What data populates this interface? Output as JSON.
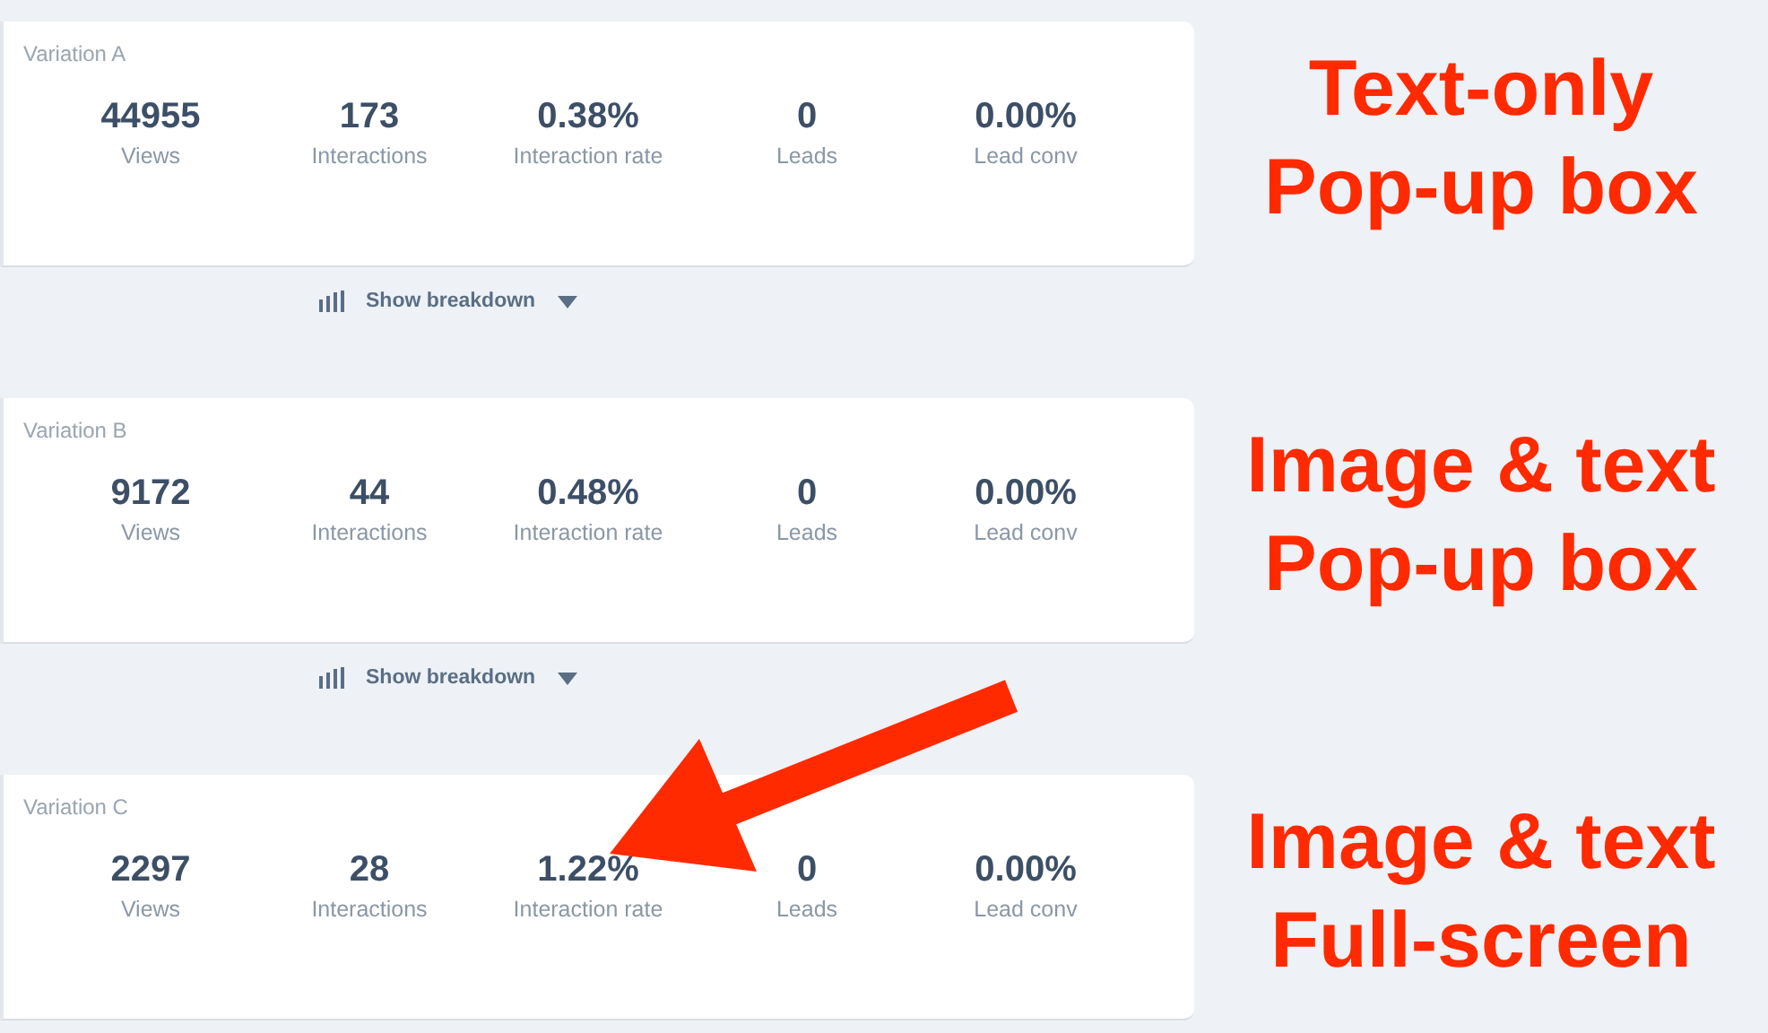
{
  "variations": [
    {
      "title": "Variation A",
      "metrics": [
        {
          "value": "44955",
          "label": "Views"
        },
        {
          "value": "173",
          "label": "Interactions"
        },
        {
          "value": "0.38%",
          "label": "Interaction rate"
        },
        {
          "value": "0",
          "label": "Leads"
        },
        {
          "value": "0.00%",
          "label": "Lead conv"
        }
      ],
      "breakdown": "Show breakdown",
      "callout": [
        "Text-only",
        "Pop-up box"
      ],
      "arrow": false
    },
    {
      "title": "Variation B",
      "metrics": [
        {
          "value": "9172",
          "label": "Views"
        },
        {
          "value": "44",
          "label": "Interactions"
        },
        {
          "value": "0.48%",
          "label": "Interaction rate"
        },
        {
          "value": "0",
          "label": "Leads"
        },
        {
          "value": "0.00%",
          "label": "Lead conv"
        }
      ],
      "breakdown": "Show breakdown",
      "callout": [
        "Image & text",
        "Pop-up box"
      ],
      "arrow": false
    },
    {
      "title": "Variation C",
      "metrics": [
        {
          "value": "2297",
          "label": "Views"
        },
        {
          "value": "28",
          "label": "Interactions"
        },
        {
          "value": "1.22%",
          "label": "Interaction rate"
        },
        {
          "value": "0",
          "label": "Leads"
        },
        {
          "value": "0.00%",
          "label": "Lead conv"
        }
      ],
      "callout": [
        "Image & text",
        "Full-screen"
      ],
      "arrow": true
    }
  ]
}
